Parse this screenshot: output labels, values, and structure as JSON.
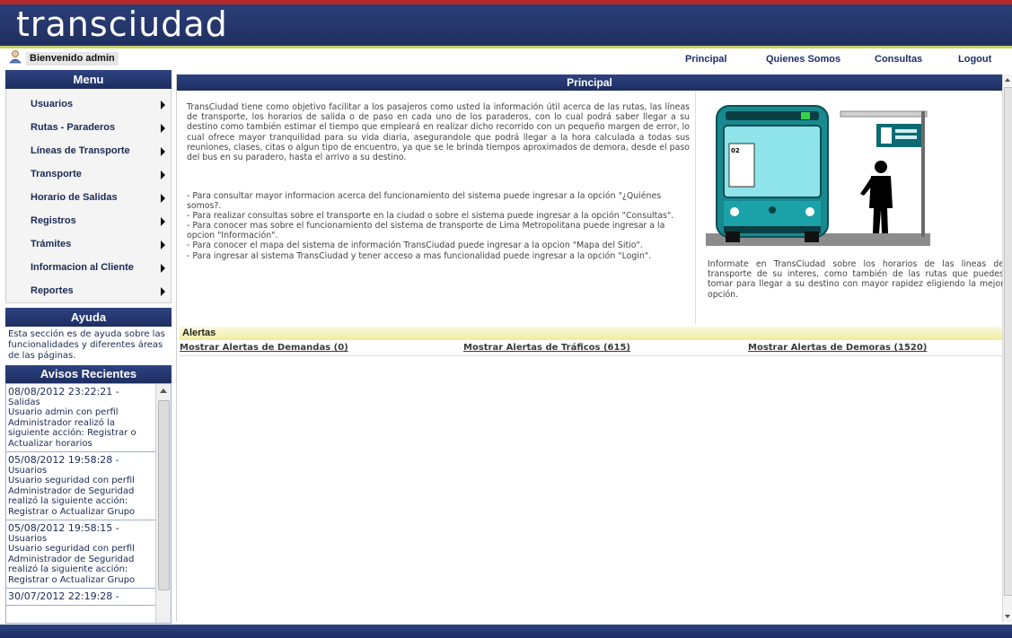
{
  "app": {
    "logo_text": "transciudad",
    "welcome": "Bienvenido admin"
  },
  "top_nav": {
    "principal": "Principal",
    "quienes_somos": "Quienes Somos",
    "consultas": "Consultas",
    "logout": "Logout"
  },
  "menu": {
    "title": "Menu",
    "items": [
      {
        "label": "Usuarios"
      },
      {
        "label": "Rutas - Paraderos"
      },
      {
        "label": "Líneas de Transporte"
      },
      {
        "label": "Transporte"
      },
      {
        "label": "Horario de Salidas"
      },
      {
        "label": "Registros"
      },
      {
        "label": "Trámites"
      },
      {
        "label": "Informacion al Cliente"
      },
      {
        "label": "Reportes"
      }
    ]
  },
  "ayuda": {
    "title": "Ayuda",
    "text": "Esta sección es de ayuda sobre las funcionalidades y diferentes áreas de las páginas."
  },
  "avisos": {
    "title": "Avisos Recientes",
    "items": [
      {
        "timestamp": "08/08/2012 23:22:21 -",
        "module": "Salidas",
        "message": "Usuario admin con perfil Administrador realizó la siguiente acción: Registrar o Actualizar horarios"
      },
      {
        "timestamp": "05/08/2012 19:58:28 -",
        "module": "Usuarios",
        "message": "Usuario seguridad con perfil Administrador de Seguridad realizó la siguiente acción: Registrar o Actualizar Grupo"
      },
      {
        "timestamp": "05/08/2012 19:58:15 -",
        "module": "Usuarios",
        "message": "Usuario seguridad con perfil Administrador de Seguridad realizó la siguiente acción: Registrar o Actualizar Grupo"
      },
      {
        "timestamp": "30/07/2012 22:19:28 -",
        "module": "",
        "message": ""
      }
    ]
  },
  "main": {
    "title": "Principal",
    "intro": "TransCiudad tiene como objetivo facilitar a los pasajeros como usted la información útil acerca de las rutas, las líneas de transporte, los horarios de salida o de paso en cada uno de los paraderos, con lo cual podrá saber llegar a su destino como también estimar el tiempo que empleará en realizar dicho recorrido con un pequeño margen de error, lo cual ofrece mayor tranquilidad para su vida diaria, asegurandole que podrá llegar a la hora calculada a todas sus reuniones, clases, citas o algun tipo de encuentro, ya que se le brinda tiempos aproximados de demora, desde el paso del bus en su paradero, hasta el arrivo a su destino.",
    "options": [
      "- Para consultar mayor informacion acerca del funcionamiento del sistema puede ingresar a la opción \"¿Quiénes somos?.",
      "- Para realizar consultas sobre el transporte en la ciudad o sobre el sistema puede ingresar a la opción \"Consultas\".",
      "- Para conocer mas sobre el funcionamiento del sistema de transporte de Lima Metropolitana puede ingresar a la opcion \"Información\".",
      "- Para conocer el mapa del sistema de información TransCiudad puede ingresar a la opcion \"Mapa del Sitio\".",
      "- Para ingresar al sistema TransCiudad y tener acceso a mas funcionalidad puede ingresar a la opción \"Login\"."
    ],
    "right_text": "Informate en TransCiudad sobre los horarios de las lineas de transporte de su interes, como también de las rutas que puedes tomar para llegar a su destino con mayor rapidez eligiendo la mejor opción.",
    "bus_number": "02"
  },
  "alertas": {
    "title": "Alertas",
    "demandas": "Mostrar Alertas de Demandas (0)",
    "traficos": "Mostrar Alertas de Tráficos (615)",
    "demoras": "Mostrar Alertas de Demoras (1520)"
  },
  "colors": {
    "header_blue": "#1f2f60",
    "accent_yellow": "#c9cf6b",
    "alert_yellow": "#f0ec9e",
    "top_strip_red": "#b52a2a"
  },
  "icons": [
    "user-icon",
    "chevron-right-icon",
    "scroll-up-icon",
    "scroll-down-icon",
    "bus-stop-illustration"
  ]
}
